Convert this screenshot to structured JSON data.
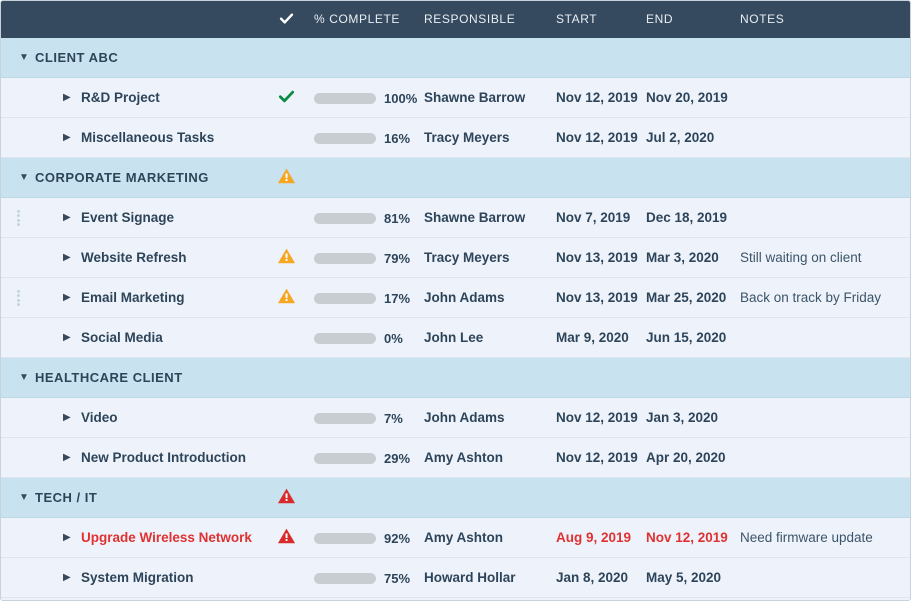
{
  "colors": {
    "header_bg": "#364a5f",
    "group_bg": "#c9e2f0",
    "task_bg": "#eef3fb",
    "accent_blue": "#1b76bc",
    "complete_green": "#0a8a43",
    "warning_orange": "#f5a623",
    "danger_red": "#d92b2b",
    "danger_text": "#e03131",
    "track_gray": "#c8cdd1"
  },
  "header": {
    "check_icon": "check-icon",
    "columns": [
      {
        "key": "pct",
        "label": "% COMPLETE"
      },
      {
        "key": "resp",
        "label": "RESPONSIBLE"
      },
      {
        "key": "start",
        "label": "START"
      },
      {
        "key": "end",
        "label": "END"
      },
      {
        "key": "notes",
        "label": "NOTES"
      }
    ]
  },
  "caret_expanded": "▼",
  "caret_collapsed": "▶",
  "rows": [
    {
      "type": "group",
      "title": "CLIENT ABC",
      "status": "none",
      "handle": false
    },
    {
      "type": "task",
      "title": "R&D Project",
      "danger": false,
      "status": "check",
      "handle": false,
      "percent": 100,
      "percent_label": "100%",
      "bar_color": "#0a8a43",
      "responsible": "Shawne Barrow",
      "start": "Nov 12, 2019",
      "end": "Nov 20, 2019",
      "notes": ""
    },
    {
      "type": "task",
      "title": "Miscellaneous Tasks",
      "danger": false,
      "status": "none",
      "handle": false,
      "percent": 16,
      "percent_label": "16%",
      "bar_color": "#1b76bc",
      "responsible": "Tracy Meyers",
      "start": "Nov 12, 2019",
      "end": "Jul 2, 2020",
      "notes": ""
    },
    {
      "type": "group",
      "title": "CORPORATE MARKETING",
      "status": "warning",
      "handle": false
    },
    {
      "type": "task",
      "title": "Event Signage",
      "danger": false,
      "status": "none",
      "handle": true,
      "percent": 81,
      "percent_label": "81%",
      "bar_color": "#1b76bc",
      "responsible": "Shawne Barrow",
      "start": "Nov 7, 2019",
      "end": "Dec 18, 2019",
      "notes": ""
    },
    {
      "type": "task",
      "title": "Website Refresh",
      "danger": false,
      "status": "warning",
      "handle": false,
      "percent": 79,
      "percent_label": "79%",
      "bar_color": "#f5a623",
      "responsible": "Tracy Meyers",
      "start": "Nov 13, 2019",
      "end": "Mar 3, 2020",
      "notes": "Still waiting on client"
    },
    {
      "type": "task",
      "title": "Email Marketing",
      "danger": false,
      "status": "warning",
      "handle": true,
      "percent": 17,
      "percent_label": "17%",
      "bar_color": "#f5a623",
      "responsible": "John Adams",
      "start": "Nov 13, 2019",
      "end": "Mar 25, 2020",
      "notes": "Back on track by Friday"
    },
    {
      "type": "task",
      "title": "Social Media",
      "danger": false,
      "status": "none",
      "handle": false,
      "percent": 0,
      "percent_label": "0%",
      "bar_color": "#1b76bc",
      "responsible": "John Lee",
      "start": "Mar 9, 2020",
      "end": "Jun 15, 2020",
      "notes": ""
    },
    {
      "type": "group",
      "title": "HEALTHCARE CLIENT",
      "status": "none",
      "handle": false
    },
    {
      "type": "task",
      "title": "Video",
      "danger": false,
      "status": "none",
      "handle": false,
      "percent": 7,
      "percent_label": "7%",
      "bar_color": "#1b76bc",
      "responsible": "John Adams",
      "start": "Nov 12, 2019",
      "end": "Jan 3, 2020",
      "notes": ""
    },
    {
      "type": "task",
      "title": "New Product Introduction",
      "danger": false,
      "status": "none",
      "handle": false,
      "percent": 29,
      "percent_label": "29%",
      "bar_color": "#1b76bc",
      "responsible": "Amy Ashton",
      "start": "Nov 12, 2019",
      "end": "Apr 20, 2020",
      "notes": ""
    },
    {
      "type": "group",
      "title": "TECH / IT",
      "status": "danger",
      "handle": false
    },
    {
      "type": "task",
      "title": "Upgrade Wireless Network",
      "danger": true,
      "status": "danger",
      "handle": false,
      "percent": 92,
      "percent_label": "92%",
      "bar_color": "#d92b2b",
      "responsible": "Amy Ashton",
      "start": "Aug 9, 2019",
      "end": "Nov 12, 2019",
      "notes": "Need firmware update"
    },
    {
      "type": "task",
      "title": "System Migration",
      "danger": false,
      "status": "none",
      "handle": false,
      "percent": 75,
      "percent_label": "75%",
      "bar_color": "#1b76bc",
      "responsible": "Howard Hollar",
      "start": "Jan 8, 2020",
      "end": "May 5, 2020",
      "notes": ""
    }
  ]
}
